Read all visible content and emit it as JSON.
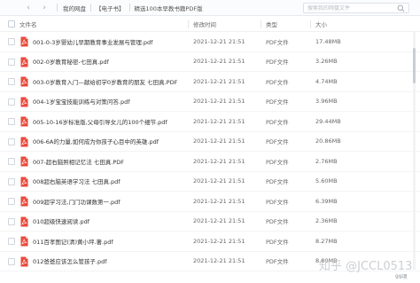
{
  "toolbar": {
    "breadcrumbs": [
      "我的网盘",
      "【电子书】",
      "精选100本早教书籍PDF版"
    ],
    "search_placeholder": "搜索我的网盘文件"
  },
  "table": {
    "columns": {
      "name": "文件名",
      "date": "修改时间",
      "type": "类型",
      "size": "大小"
    },
    "rows": [
      {
        "name": "001-0-3岁婴幼儿早期教育事业发展与管理.pdf",
        "date": "2021-12-21 21:51",
        "type": "PDF文件",
        "size": "17.48MB"
      },
      {
        "name": "002-0岁教育秘密-七田真.pdf",
        "date": "2021-12-21 21:51",
        "type": "PDF文件",
        "size": "3.26MB"
      },
      {
        "name": "003-0岁教育入门—献给初学0岁教育的朋友 七田真.PDF",
        "date": "2021-12-21 21:51",
        "type": "PDF文件",
        "size": "4.74MB"
      },
      {
        "name": "004-1岁宝宝技能训练与对策问答.pdf",
        "date": "2021-12-21 21:51",
        "type": "PDF文件",
        "size": "3.96MB"
      },
      {
        "name": "005-10-16岁标准版,父母引导女儿的100个细节.pdf",
        "date": "2021-12-21 21:51",
        "type": "PDF文件",
        "size": "29.44MB"
      },
      {
        "name": "006-6A的力量,如何成为你孩子心目中的英雄.pdf",
        "date": "2021-12-21 21:51",
        "type": "PDF文件",
        "size": "20.86MB"
      },
      {
        "name": "007-超右脑照相记忆法 七田真.PDF",
        "date": "2021-12-21 21:51",
        "type": "PDF文件",
        "size": "2.76MB"
      },
      {
        "name": "008超右脑英语学习法 七田真.pdf",
        "date": "2021-12-21 21:51",
        "type": "PDF文件",
        "size": "5.60MB"
      },
      {
        "name": "009超学习法,门门功课数第一.pdf",
        "date": "2021-12-21 21:51",
        "type": "PDF文件",
        "size": "6.39MB"
      },
      {
        "name": "010超级快速阅读.pdf",
        "date": "2021-12-21 21:51",
        "type": "PDF文件",
        "size": "2.36MB"
      },
      {
        "name": "011百孝图记(清)黄小坪.著.pdf",
        "date": "2021-12-21 21:51",
        "type": "PDF文件",
        "size": "8.27MB"
      },
      {
        "name": "012爸爸应该怎么管孩子.pdf",
        "date": "2021-12-21 21:51",
        "type": "PDF文件",
        "size": "8.80MB"
      }
    ]
  },
  "footer": {
    "count": "99项"
  },
  "watermark": {
    "text": "知乎 @JCCL0513"
  },
  "colors": {
    "pdf_red": "#e84a3c",
    "accent": "#3b8cff"
  },
  "icons": {
    "row_icon": "pdf-file-icon",
    "search": "search-icon",
    "back": "back-arrow-icon",
    "forward": "forward-arrow-icon"
  }
}
